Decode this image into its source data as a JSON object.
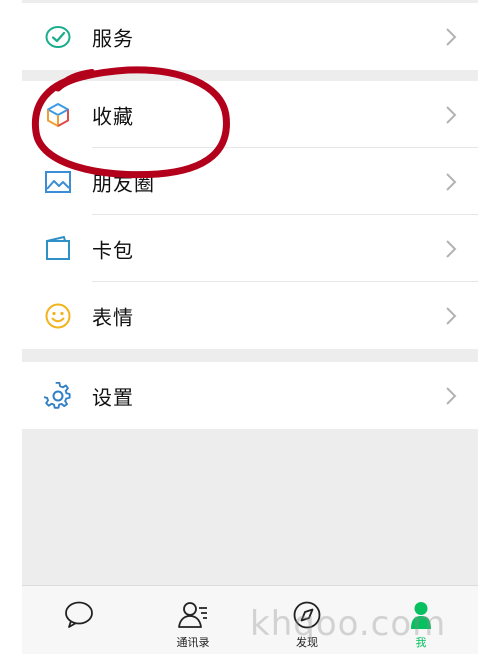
{
  "menu": {
    "top_group": [
      {
        "id": "services",
        "label": "服务",
        "icon": "services-check-icon"
      }
    ],
    "middle_group": [
      {
        "id": "favorites",
        "label": "收藏",
        "icon": "cube-icon"
      },
      {
        "id": "moments",
        "label": "朋友圈",
        "icon": "photo-icon"
      },
      {
        "id": "cards",
        "label": "卡包",
        "icon": "wallet-icon"
      },
      {
        "id": "stickers",
        "label": "表情",
        "icon": "smiley-icon"
      }
    ],
    "bottom_group": [
      {
        "id": "settings",
        "label": "设置",
        "icon": "gear-icon"
      }
    ]
  },
  "tabbar": {
    "chats_label": "",
    "contacts_label": "通讯录",
    "discover_label": "发现",
    "me_label": "我"
  },
  "watermark": "khqoo.com",
  "colors": {
    "accent_green": "#07c160",
    "annotation_red": "#b3001b",
    "background": "#ededed"
  }
}
